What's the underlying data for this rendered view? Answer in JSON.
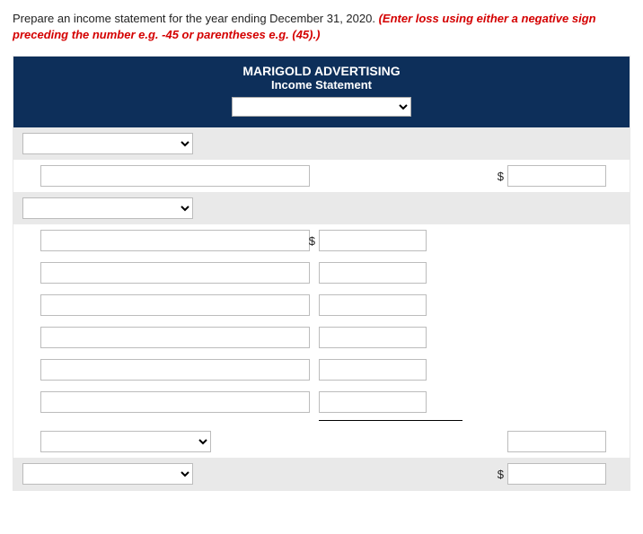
{
  "instruction": {
    "main": "Prepare an income statement for the year ending December 31, 2020. ",
    "red": "(Enter loss using either a negative sign preceding the number e.g. -45 or parentheses e.g. (45).)"
  },
  "header": {
    "company": "MARIGOLD ADVERTISING",
    "statement": "Income Statement",
    "period_select": ""
  },
  "rows": {
    "section1_select": "",
    "section1_label": "",
    "section1_amount": "",
    "section2_select": "",
    "exp1_label": "",
    "exp1_amount": "",
    "exp2_label": "",
    "exp2_amount": "",
    "exp3_label": "",
    "exp3_amount": "",
    "exp4_label": "",
    "exp4_amount": "",
    "exp5_label": "",
    "exp5_amount": "",
    "exp6_label": "",
    "exp6_amount": "",
    "total_exp_select": "",
    "total_exp_amount": "",
    "net_select": "",
    "net_amount": ""
  },
  "symbols": {
    "dollar": "$"
  }
}
